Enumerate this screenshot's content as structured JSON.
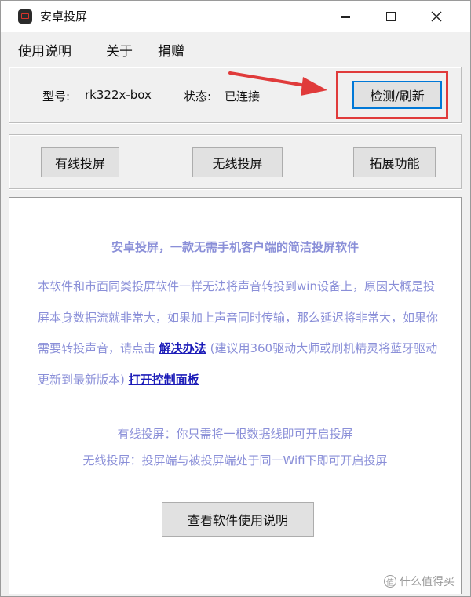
{
  "window": {
    "title": "安卓投屏",
    "controls": {
      "minimize": "minimize-icon",
      "maximize": "maximize-icon",
      "close": "close-icon"
    }
  },
  "menu": {
    "items": [
      "使用说明",
      "关于",
      "捐赠"
    ]
  },
  "device": {
    "model_label": "型号:",
    "model_value": "rk322x-box",
    "status_label": "状态:",
    "status_value": "已连接",
    "refresh_button": "检测/刷新"
  },
  "actions": {
    "wired": "有线投屏",
    "wireless": "无线投屏",
    "extend": "拓展功能"
  },
  "info": {
    "headline": "安卓投屏，一款无需手机客户端的简洁投屏软件",
    "paragraph_part1": "本软件和市面同类投屏软件一样无法将声音转投到win设备上，原因大概是投屏本身数据流就非常大，如果加上声音同时传输，那么延迟将非常大，如果你需要转投声音，请点击",
    "solution_link": "解决办法",
    "paragraph_part2": "(建议用360驱动大师或刷机精灵将蓝牙驱动更新到最新版本)",
    "control_panel_link": "打开控制面板",
    "wired_tip": "有线投屏：你只需将一根数据线即可开启投屏",
    "wireless_tip": "无线投屏：投屏端与被投屏端处于同一Wifi下即可开启投屏",
    "manual_button": "查看软件使用说明"
  },
  "watermark": {
    "icon": "value-icon",
    "text": "什么值得买"
  },
  "colors": {
    "info_text": "#8a8fd8",
    "link": "#1b1bb8",
    "highlight": "#e03b3b"
  }
}
